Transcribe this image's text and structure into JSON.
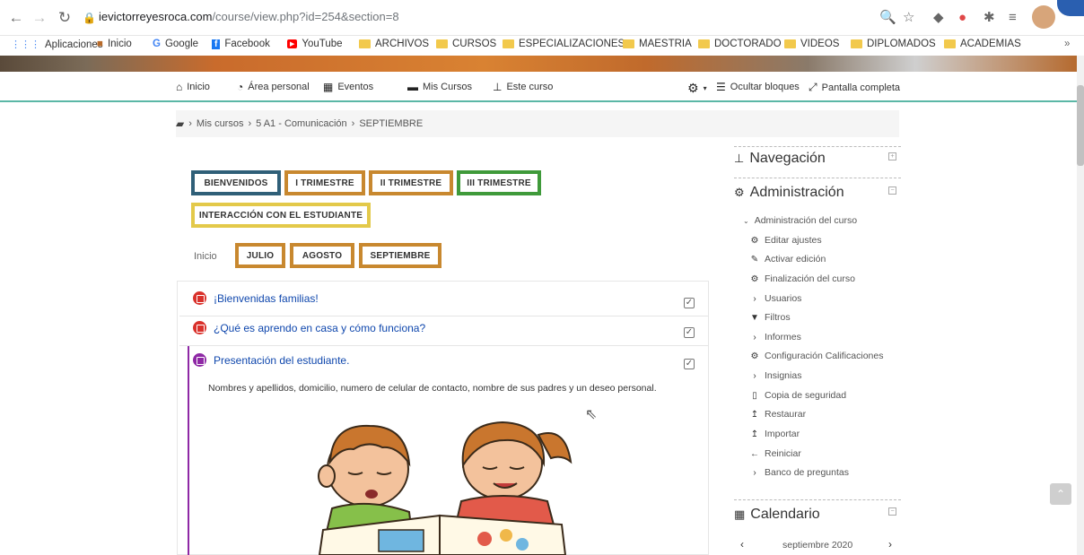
{
  "browser": {
    "url_host": "ievictorreyesroca.com",
    "url_path": "/course/view.php?id=254&section=8",
    "bookmarks": [
      "Aplicaciones",
      "Inicio",
      "Google",
      "Facebook",
      "YouTube",
      "ARCHIVOS",
      "CURSOS",
      "ESPECIALIZACIONES",
      "MAESTRIA",
      "DOCTORADO",
      "VIDEOS",
      "DIPLOMADOS",
      "ACADEMIAS"
    ],
    "more": "»"
  },
  "nav": {
    "inicio": "Inicio",
    "area_personal": "Área personal",
    "eventos": "Eventos",
    "mis_cursos": "Mis Cursos",
    "este_curso": "Este curso",
    "ocultar_bloques": "Ocultar bloques",
    "pantalla_completa": "Pantalla completa"
  },
  "breadcrumb": [
    "Mis cursos",
    "5 A1 - Comunicación",
    "SEPTIEMBRE"
  ],
  "tabs": {
    "row1": [
      "BIENVENIDOS",
      "I TRIMESTRE",
      "II TRIMESTRE",
      "III TRIMESTRE"
    ],
    "row2": [
      "INTERACCIÓN CON EL ESTUDIANTE"
    ],
    "inicio": "Inicio",
    "months": [
      "JULIO",
      "AGOSTO",
      "SEPTIEMBRE"
    ]
  },
  "activities": [
    {
      "label": "¡Bienvenidas familias!"
    },
    {
      "label": "¿Qué es aprendo en casa y cómo funciona?"
    },
    {
      "label": "Presentación del estudiante."
    }
  ],
  "description": "Nombres  y apellidos, domicilio, numero de celular de contacto, nombre de sus padres y un deseo personal.",
  "sidebar": {
    "navegacion": "Navegación",
    "administracion": "Administración",
    "admin_curso": "Administración del curso",
    "items": [
      "Editar ajustes",
      "Activar edición",
      "Finalización del curso",
      "Usuarios",
      "Filtros",
      "Informes",
      "Configuración Calificaciones",
      "Insignias",
      "Copia de seguridad",
      "Restaurar",
      "Importar",
      "Reiniciar",
      "Banco de preguntas"
    ],
    "calendario": "Calendario",
    "calendar_month": "septiembre 2020"
  },
  "colors": {
    "accent": "#5bb7a6",
    "link": "#0f47ad",
    "tab_blue": "#2f5f78",
    "tab_orange": "#c8882f",
    "tab_green": "#3f9a3a",
    "tab_yellow": "#e3c94a"
  }
}
